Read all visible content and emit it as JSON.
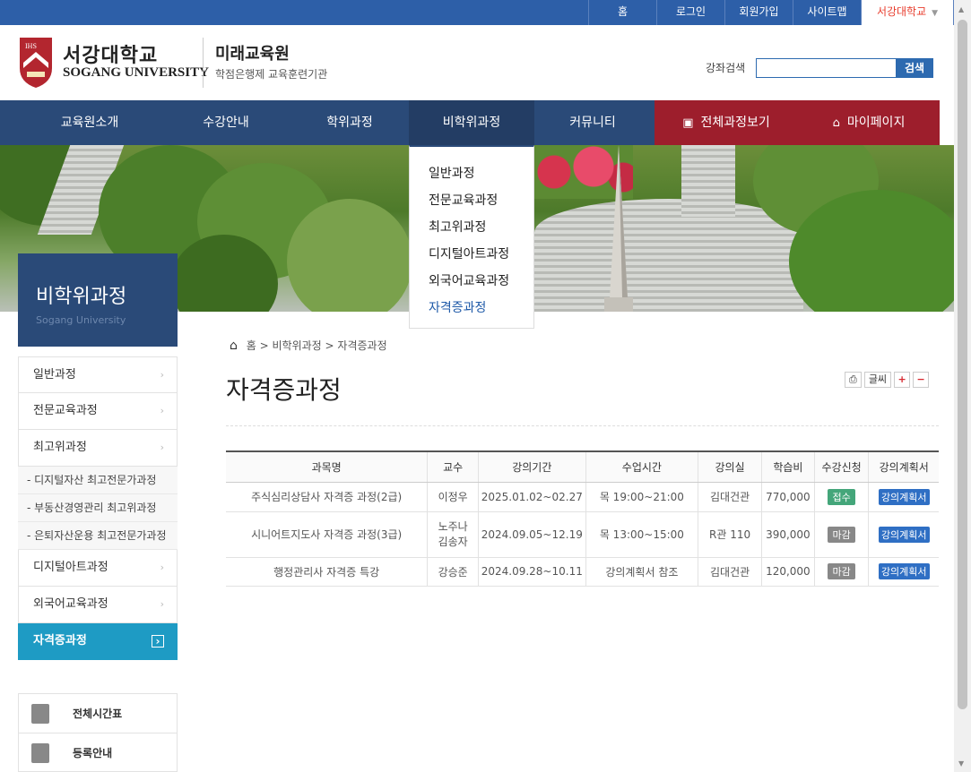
{
  "top_links": [
    "홈",
    "로그인",
    "회원가입",
    "사이트맵",
    "서강대학교"
  ],
  "logo": {
    "korean": "서강대학교",
    "english": "SOGANG UNIVERSITY",
    "shield_text": "IHS"
  },
  "institute": {
    "name": "미래교육원",
    "subtitle": "학점은행제 교육훈련기관"
  },
  "search": {
    "label": "강좌검색",
    "button": "검색",
    "value": ""
  },
  "nav": [
    "교육원소개",
    "수강안내",
    "학위과정",
    "비학위과정",
    "커뮤니티"
  ],
  "nav_special": {
    "all_courses": "전체과정보기",
    "mypage": "마이페이지"
  },
  "dropdown": [
    "일반과정",
    "전문교육과정",
    "최고위과정",
    "디지털아트과정",
    "외국어교육과정",
    "자격증과정"
  ],
  "side_title": {
    "title": "비학위과정",
    "subtitle": "Sogang University"
  },
  "side_menu": {
    "general": "일반과정",
    "professional": "전문교육과정",
    "executive": "최고위과정",
    "sub": [
      "- 디지털자산 최고전문가과정",
      "- 부동산경영관리 최고위과정",
      "- 은퇴자산운용 최고전문가과정"
    ],
    "digital_art": "디지털아트과정",
    "foreign": "외국어교육과정",
    "certificate": "자격증과정"
  },
  "quick": [
    "전체시간표",
    "등록안내"
  ],
  "breadcrumb": {
    "home": "홈",
    "level1": "비학위과정",
    "level2": "자격증과정",
    "sep": ">"
  },
  "page_title": "자격증과정",
  "tools": {
    "print": "⎙",
    "font": "글씨",
    "plus": "+",
    "minus": "−"
  },
  "table": {
    "headers": [
      "과목명",
      "교수",
      "강의기간",
      "수업시간",
      "강의실",
      "학습비",
      "수강신청",
      "강의계획서"
    ],
    "rows": [
      {
        "course": "주식심리상담사 자격증 과정(2급)",
        "prof": "이정우",
        "period": "2025.01.02~02.27",
        "time": "목 19:00~21:00",
        "room": "김대건관",
        "fee": "770,000",
        "status": "접수",
        "status_type": "open",
        "plan": "강의계획서"
      },
      {
        "course": "시니어트지도사 자격증 과정(3급)",
        "prof": "노주나\n김송자",
        "period": "2024.09.05~12.19",
        "time": "목 13:00~15:00",
        "room": "R관 110",
        "fee": "390,000",
        "status": "마감",
        "status_type": "closed",
        "plan": "강의계획서"
      },
      {
        "course": "행정관리사 자격증 특강",
        "prof": "강승준",
        "period": "2024.09.28~10.11",
        "time": "강의계획서 참조",
        "room": "김대건관",
        "fee": "120,000",
        "status": "마감",
        "status_type": "closed",
        "plan": "강의계획서"
      }
    ]
  },
  "colors": {
    "topbar": "#2d5fa8",
    "nav": "#2a4a78",
    "nav_red": "#9d1e2c",
    "active": "#1e9bc4",
    "accent": "#2d6ab0"
  }
}
